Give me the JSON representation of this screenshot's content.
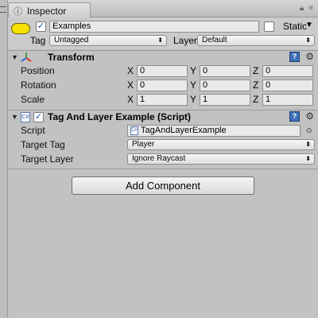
{
  "window": {
    "tab_label": "Inspector",
    "tab_icon": "info-icon",
    "lock_icon": "lock-icon",
    "menu_icon": "panel-menu-icon"
  },
  "game_object": {
    "icon": "gameobject-icon",
    "active": true,
    "name": "Examples",
    "static_label": "Static",
    "static_checked": false,
    "tag_label": "Tag",
    "tag_value": "Untagged",
    "layer_label": "Layer",
    "layer_value": "Default"
  },
  "transform": {
    "title": "Transform",
    "icon": "transform-axes-icon",
    "rows": [
      {
        "label": "Position",
        "x": "0",
        "y": "0",
        "z": "0"
      },
      {
        "label": "Rotation",
        "x": "0",
        "y": "0",
        "z": "0"
      },
      {
        "label": "Scale",
        "x": "1",
        "y": "1",
        "z": "1"
      }
    ],
    "axis_labels": [
      "X",
      "Y",
      "Z"
    ]
  },
  "script_component": {
    "title": "Tag And Layer Example (Script)",
    "enabled": true,
    "icon": "script-icon",
    "script_label": "Script",
    "script_value": "TagAndLayerExample",
    "target_tag_label": "Target Tag",
    "target_tag_value": "Player",
    "target_layer_label": "Target Layer",
    "target_layer_value": "Ignore Raycast"
  },
  "add_component_label": "Add Component",
  "colors": {
    "panel_bg": "#c2c2c2",
    "gameobject_icon": "#f5e200",
    "help_icon": "#3d6fb8",
    "check_mark": "#1d4fae"
  }
}
